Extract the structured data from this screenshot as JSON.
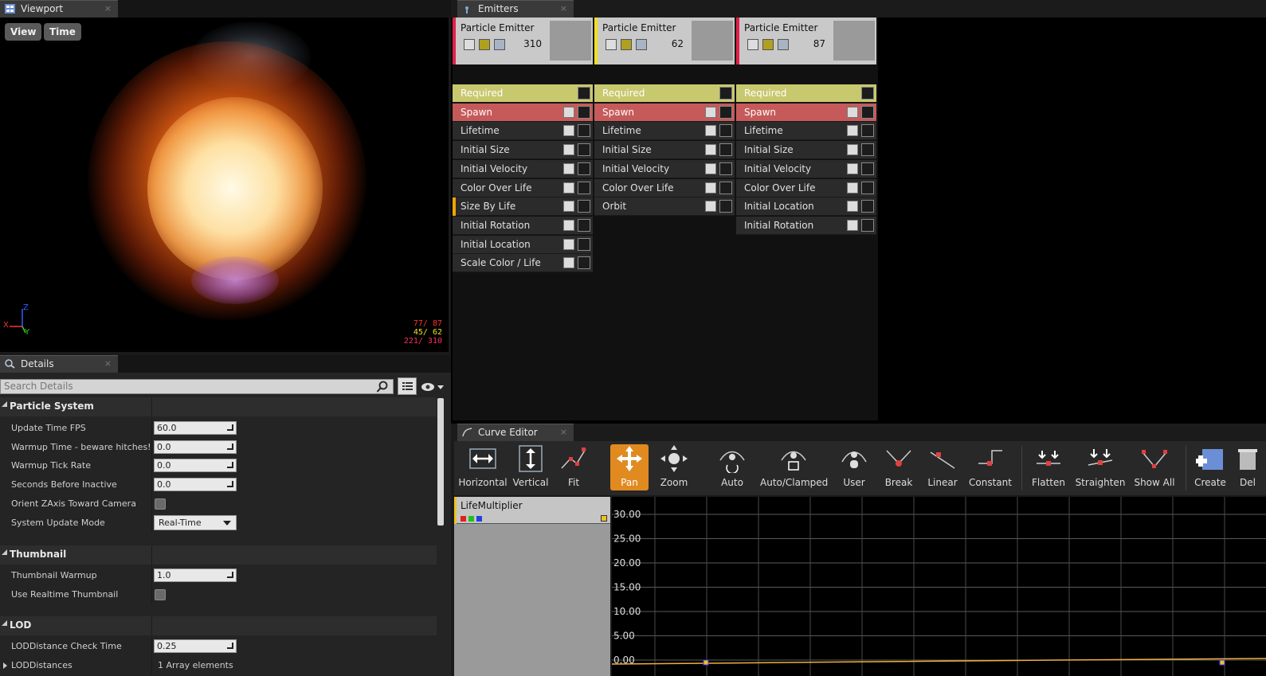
{
  "viewport": {
    "tab_title": "Viewport",
    "close_glyph": "×",
    "buttons": {
      "view": "View",
      "time": "Time"
    },
    "axis": {
      "z": "Z",
      "x": "X",
      "y": "Y"
    },
    "stats": [
      {
        "text": "77/  87",
        "color": "#ff3030"
      },
      {
        "text": "45/  62",
        "color": "#f0e020"
      },
      {
        "text": "221/ 310",
        "color": "#ff3060"
      }
    ]
  },
  "details": {
    "tab_title": "Details",
    "close_glyph": "×",
    "search_placeholder": "Search Details",
    "categories": {
      "particle_system": "Particle System",
      "thumbnail": "Thumbnail",
      "lod": "LOD"
    },
    "props": {
      "update_time_fps": {
        "label": "Update Time FPS",
        "value": "60.0"
      },
      "warmup_time": {
        "label": "Warmup Time - beware hitches!",
        "value": "0.0"
      },
      "warmup_tick_rate": {
        "label": "Warmup Tick Rate",
        "value": "0.0"
      },
      "seconds_before_inactive": {
        "label": "Seconds Before Inactive",
        "value": "0.0"
      },
      "orient_zaxis": {
        "label": "Orient ZAxis Toward Camera",
        "checked": false
      },
      "system_update_mode": {
        "label": "System Update Mode",
        "value": "Real-Time"
      },
      "thumbnail_warmup": {
        "label": "Thumbnail Warmup",
        "value": "1.0"
      },
      "use_realtime_thumbnail": {
        "label": "Use Realtime Thumbnail",
        "checked": false
      },
      "lod_check_time": {
        "label": "LODDistance Check Time",
        "value": "0.25"
      },
      "lod_distances": {
        "label": "LODDistances",
        "value": "1 Array elements"
      }
    }
  },
  "emitters": {
    "tab_title": "Emitters",
    "close_glyph": "×",
    "columns": [
      {
        "name": "Particle Emitter",
        "count": "310",
        "accent": "#e0204a",
        "modules": [
          "Required",
          "Spawn",
          "Lifetime",
          "Initial Size",
          "Initial Velocity",
          "Color Over Life",
          "Size By Life",
          "Initial Rotation",
          "Initial Location",
          "Scale Color / Life"
        ]
      },
      {
        "name": "Particle Emitter",
        "count": "62",
        "accent": "#f0e020",
        "modules": [
          "Required",
          "Spawn",
          "Lifetime",
          "Initial Size",
          "Initial Velocity",
          "Color Over Life",
          "Orbit"
        ]
      },
      {
        "name": "Particle Emitter",
        "count": "87",
        "accent": "#e0204a",
        "modules": [
          "Required",
          "Spawn",
          "Lifetime",
          "Initial Size",
          "Initial Velocity",
          "Color Over Life",
          "Initial Location",
          "Initial Rotation"
        ]
      }
    ]
  },
  "curve_editor": {
    "tab_title": "Curve Editor",
    "close_glyph": "×",
    "tools": {
      "horizontal": "Horizontal",
      "vertical": "Vertical",
      "fit": "Fit",
      "pan": "Pan",
      "zoom": "Zoom",
      "auto": "Auto",
      "auto_clamped": "Auto/Clamped",
      "user": "User",
      "break": "Break",
      "linear": "Linear",
      "constant": "Constant",
      "flatten": "Flatten",
      "straighten": "Straighten",
      "show_all": "Show All",
      "create": "Create",
      "delete": "Del"
    },
    "curve_name": "LifeMultiplier",
    "y_ticks": [
      "30.00",
      "25.00",
      "20.00",
      "15.00",
      "10.00",
      "5.00",
      "0.00"
    ],
    "colors": {
      "active_tool": "#e08a20",
      "curve": "#f0b040"
    }
  }
}
